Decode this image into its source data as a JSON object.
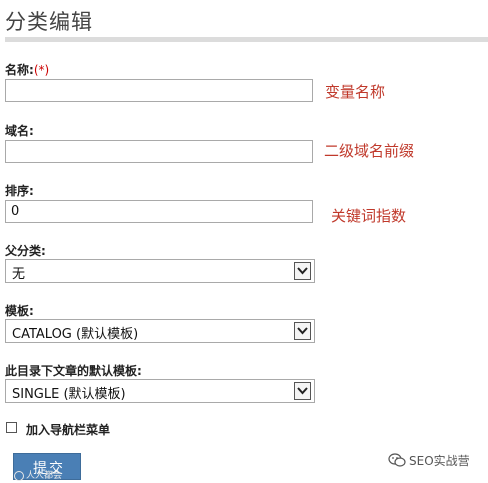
{
  "page": {
    "title": "分类编辑"
  },
  "form": {
    "name": {
      "label": "名称:",
      "required_mark": "(*)",
      "value": "",
      "annotation": "变量名称"
    },
    "domain": {
      "label": "域名:",
      "value": "",
      "annotation": "二级域名前缀"
    },
    "order": {
      "label": "排序:",
      "value": "0",
      "annotation": "关键词指数"
    },
    "parent": {
      "label": "父分类:",
      "selected": "无"
    },
    "template": {
      "label": "模板:",
      "selected": "CATALOG (默认模板)"
    },
    "article_template": {
      "label": "此目录下文章的默认模板:",
      "selected": "SINGLE (默认模板)"
    },
    "nav_menu": {
      "label": "加入导航栏菜单",
      "checked": false
    },
    "submit_label": "提交"
  },
  "watermarks": {
    "left": "人人都会",
    "right": "SEO实战营"
  },
  "colors": {
    "annotation": "#c0392b",
    "required": "#cc0000",
    "button": "#4a7fb5"
  },
  "icons": {
    "dropdown": "chevron-down-icon",
    "checkbox": "checkbox-icon",
    "watermark": "wechat-icon"
  }
}
